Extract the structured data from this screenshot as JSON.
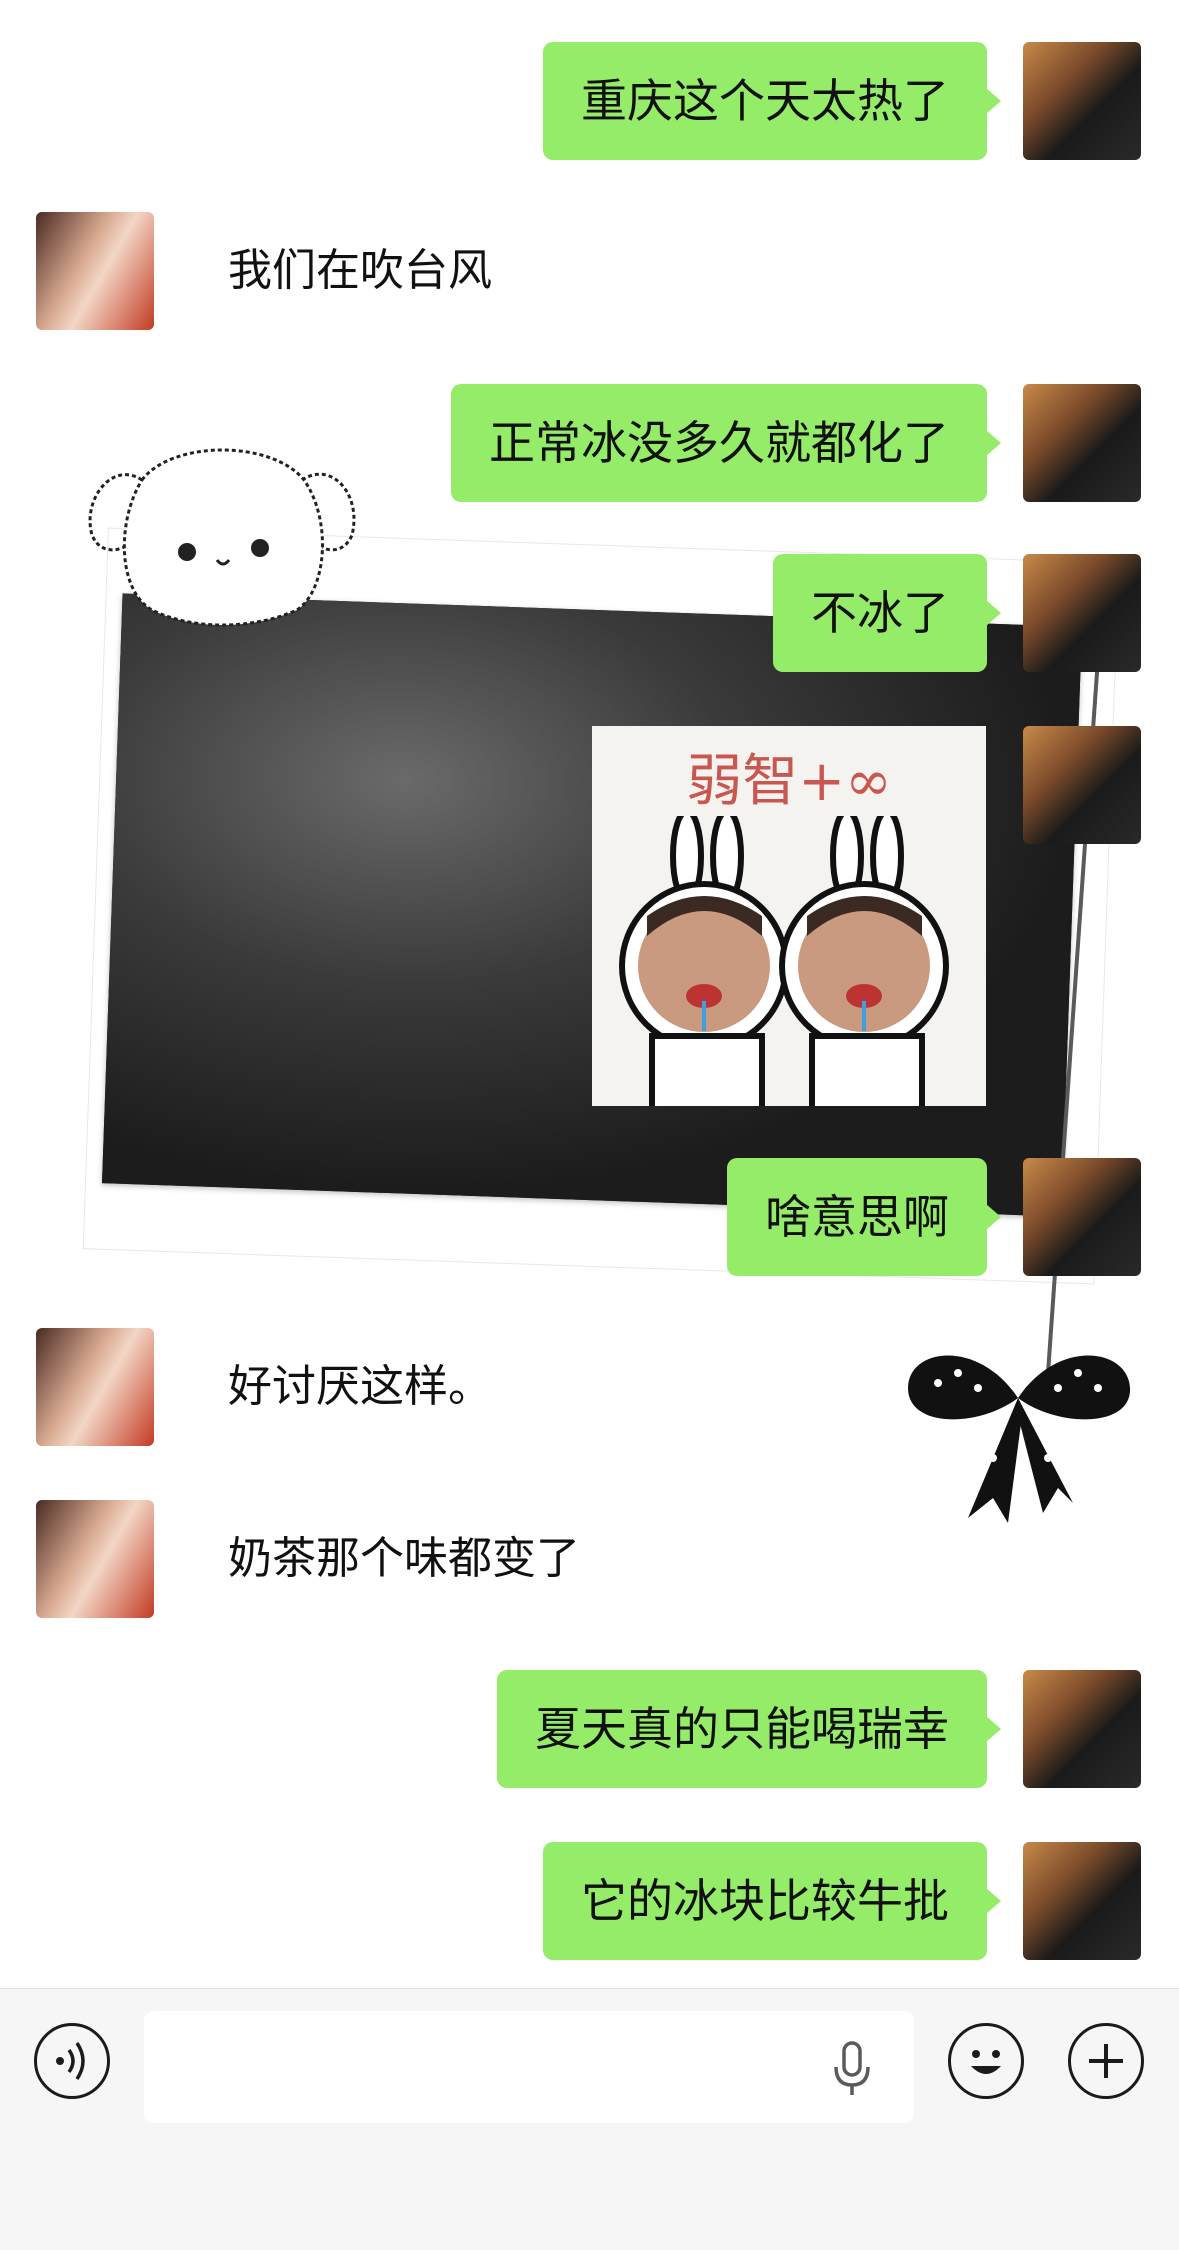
{
  "chat": {
    "messages": [
      {
        "from": "me",
        "type": "text",
        "text": "重庆这个天太热了"
      },
      {
        "from": "her",
        "type": "text",
        "text": "我们在吹台风"
      },
      {
        "from": "me",
        "type": "text",
        "text": "正常冰没多久就都化了"
      },
      {
        "from": "me",
        "type": "text",
        "text": "不冰了"
      },
      {
        "from": "me",
        "type": "sticker",
        "text": "弱智+∞"
      },
      {
        "from": "me",
        "type": "text",
        "text": "啥意思啊"
      },
      {
        "from": "her",
        "type": "text",
        "text": "好讨厌这样。"
      },
      {
        "from": "her",
        "type": "text",
        "text": "奶茶那个味都变了"
      },
      {
        "from": "me",
        "type": "text",
        "text": "夏天真的只能喝瑞幸"
      },
      {
        "from": "me",
        "type": "text",
        "text": "它的冰块比较牛批"
      }
    ]
  },
  "input_bar": {
    "voice_icon": "voice-wave-icon",
    "mic_icon": "microphone-icon",
    "emoji_icon": "smiley-face-icon",
    "plus_icon": "plus-icon",
    "input_value": ""
  },
  "colors": {
    "bubble_me": "#95ec69",
    "background": "#ffffff",
    "input_bar": "#f6f6f6"
  }
}
